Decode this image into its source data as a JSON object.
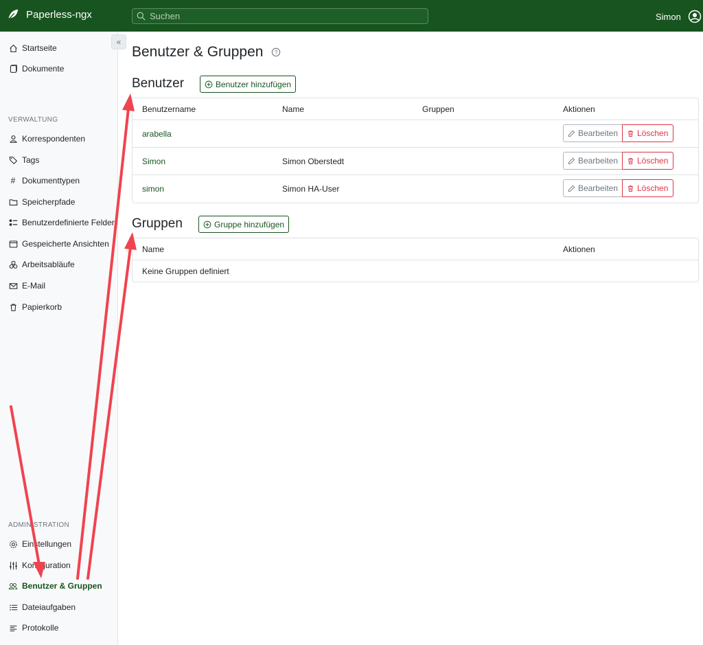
{
  "app": {
    "name": "Paperless-ngx"
  },
  "search": {
    "placeholder": "Suchen"
  },
  "user": {
    "name": "Simon"
  },
  "sidebar": {
    "top_items": [
      {
        "label": "Startseite",
        "icon": "house-icon"
      },
      {
        "label": "Dokumente",
        "icon": "files-icon"
      }
    ],
    "section_verwaltung": "VERWALTUNG",
    "verwaltung_items": [
      {
        "label": "Korrespondenten",
        "icon": "person-icon"
      },
      {
        "label": "Tags",
        "icon": "tags-icon"
      },
      {
        "label": "Dokumenttypen",
        "icon": "hash-icon"
      },
      {
        "label": "Speicherpfade",
        "icon": "folder-icon"
      },
      {
        "label": "Benutzerdefinierte Felder",
        "icon": "ui-checks-icon"
      },
      {
        "label": "Gespeicherte Ansichten",
        "icon": "window-stack-icon"
      },
      {
        "label": "Arbeitsabläufe",
        "icon": "boxes-icon"
      },
      {
        "label": "E-Mail",
        "icon": "envelope-icon"
      },
      {
        "label": "Papierkorb",
        "icon": "trash-icon"
      }
    ],
    "section_admin": "ADMINISTRATION",
    "admin_items": [
      {
        "label": "Einstellungen",
        "icon": "gear-icon"
      },
      {
        "label": "Konfiguration",
        "icon": "sliders-icon"
      },
      {
        "label": "Benutzer & Gruppen",
        "icon": "people-icon",
        "active": true
      },
      {
        "label": "Dateiaufgaben",
        "icon": "list-task-icon"
      },
      {
        "label": "Protokolle",
        "icon": "text-left-icon"
      }
    ]
  },
  "page": {
    "title": "Benutzer & Gruppen"
  },
  "users": {
    "title": "Benutzer",
    "add_label": "Benutzer hinzufügen",
    "columns": [
      "Benutzername",
      "Name",
      "Gruppen",
      "Aktionen"
    ],
    "rows": [
      {
        "username": "arabella",
        "name": "",
        "groups": ""
      },
      {
        "username": "Simon",
        "name": "Simon Oberstedt",
        "groups": ""
      },
      {
        "username": "simon",
        "name": "Simon HA-User",
        "groups": ""
      }
    ],
    "edit_label": "Bearbeiten",
    "delete_label": "Löschen"
  },
  "groups": {
    "title": "Gruppen",
    "add_label": "Gruppe hinzufügen",
    "columns": [
      "Name",
      "Aktionen"
    ],
    "empty_text": "Keine Gruppen definiert"
  },
  "colors": {
    "brand": "#17541f",
    "danger": "#dc3545",
    "annotation": "#f0434f"
  }
}
